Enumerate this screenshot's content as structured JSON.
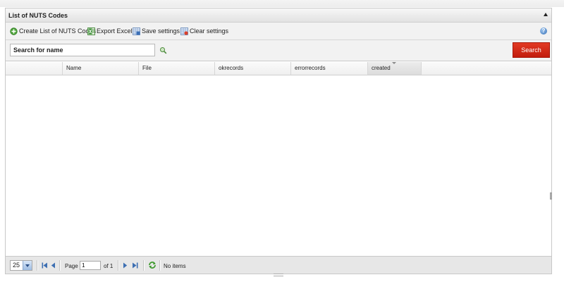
{
  "panel": {
    "title": "List of NUTS Codes"
  },
  "toolbar": {
    "items": [
      {
        "label": "Create List of NUTS Codes",
        "icon": "add-icon"
      },
      {
        "label": "Export Excel",
        "icon": "excel-icon"
      },
      {
        "label": "Save settings",
        "icon": "save-settings-icon"
      },
      {
        "label": "Clear settings",
        "icon": "clear-settings-icon"
      }
    ],
    "help_icon": "help-icon"
  },
  "search": {
    "placeholder": "Search for name",
    "value": "",
    "button_label": "Search",
    "button_color": "#d22a17"
  },
  "grid": {
    "columns": [
      {
        "label": ""
      },
      {
        "label": "Name"
      },
      {
        "label": "File"
      },
      {
        "label": "okrecords"
      },
      {
        "label": "errorrecords"
      },
      {
        "label": "created"
      }
    ],
    "sorted_column": "created",
    "rows": []
  },
  "pager": {
    "page_size": "25",
    "page_label": "Page",
    "page_value": "1",
    "of_label": "of 1",
    "status": "No items"
  }
}
